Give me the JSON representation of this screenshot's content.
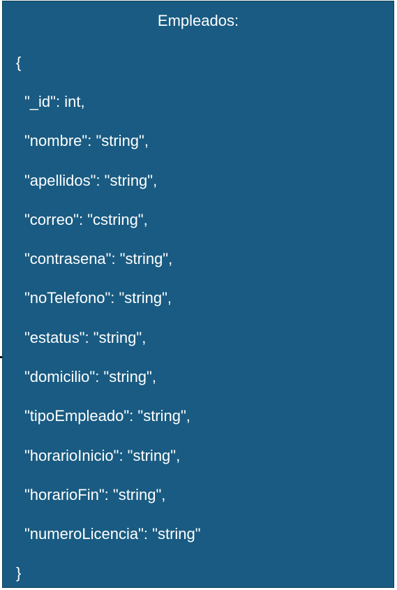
{
  "entity": {
    "title": "Empleados:",
    "open_brace": "{",
    "close_brace": "}",
    "fields": [
      "\"_id\": int,",
      "\"nombre\": \"string\",",
      "\"apellidos\": \"string\",",
      "\"correo\": \"cstring\",",
      "\"contrasena\": \"string\",",
      "\"noTelefono\": \"string\",",
      "\"estatus\": \"string\",",
      "\"domicilio\": \"string\",",
      "\"tipoEmpleado\": \"string\",",
      "\"horarioInicio\": \"string\",",
      "\"horarioFin\": \"string\",",
      "\"numeroLicencia\": \"string\""
    ]
  },
  "colors": {
    "box_fill": "#195b82",
    "text": "#ffffff"
  }
}
